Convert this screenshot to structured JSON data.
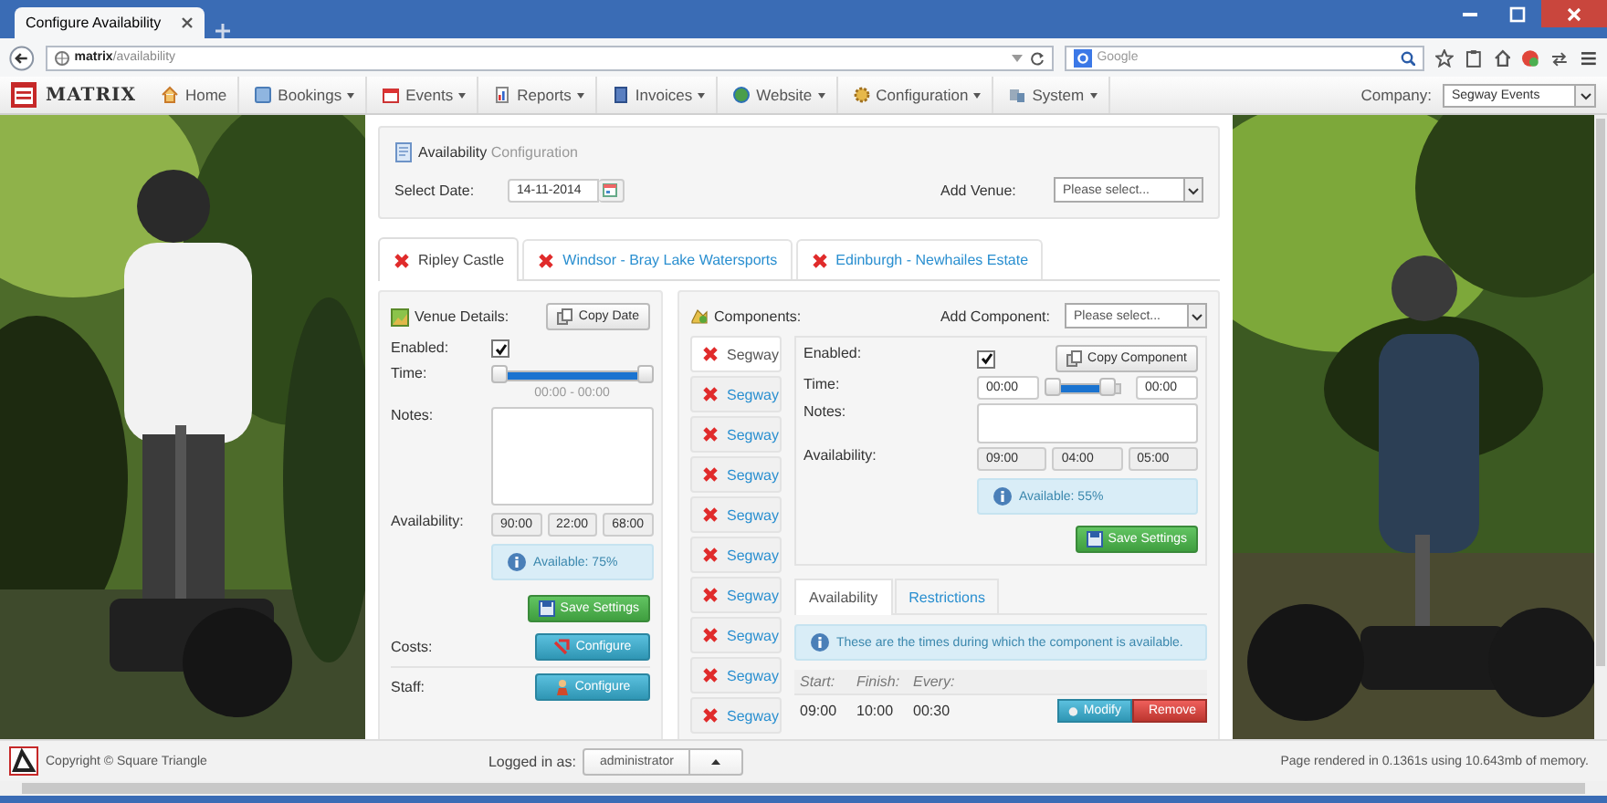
{
  "browser": {
    "tab_title": "Configure Availability",
    "url": {
      "host": "matrix",
      "path": "/availability"
    },
    "search": {
      "placeholder": "Google"
    }
  },
  "navbar": {
    "logo": "MATRIX",
    "items": [
      {
        "label": "Home",
        "dropdown": false,
        "kind": "home"
      },
      {
        "label": "Bookings",
        "dropdown": true,
        "kind": "bookings"
      },
      {
        "label": "Events",
        "dropdown": true,
        "kind": "events"
      },
      {
        "label": "Reports",
        "dropdown": true,
        "kind": "reports"
      },
      {
        "label": "Invoices",
        "dropdown": true,
        "kind": "invoices"
      },
      {
        "label": "Website",
        "dropdown": true,
        "kind": "website"
      },
      {
        "label": "Configuration",
        "dropdown": true,
        "kind": "configuration"
      },
      {
        "label": "System",
        "dropdown": true,
        "kind": "system"
      }
    ],
    "company": {
      "label": "Company:",
      "value": "Segway Events"
    }
  },
  "header": {
    "title": "Availability",
    "subtitle": "Configuration",
    "select_date": {
      "label": "Select Date:",
      "value": "14-11-2014"
    },
    "add_venue": {
      "label": "Add Venue:",
      "placeholder": "Please select..."
    }
  },
  "venue_tabs": [
    {
      "label": "Ripley Castle",
      "selected": true
    },
    {
      "label": "Windsor - Bray Lake Watersports",
      "selected": false
    },
    {
      "label": "Edinburgh - Newhailes Estate",
      "selected": false
    }
  ],
  "venue": {
    "heading": "Venue Details:",
    "copy_button": "Copy Date",
    "enabled": {
      "label": "Enabled:",
      "checked": true
    },
    "time": {
      "label": "Time:",
      "level": 1,
      "reading": "00:00 - 00:00"
    },
    "notes": {
      "label": "Notes:"
    },
    "availability": {
      "label": "Availability:",
      "values": [
        "90:00",
        "22:00",
        "68:00"
      ],
      "note": "Available: 75%"
    },
    "save_button": "Save Settings",
    "costs": {
      "label": "Costs:",
      "button": "Configure"
    },
    "staff": {
      "label": "Staff:",
      "button": "Configure"
    }
  },
  "components": {
    "heading": "Components:",
    "add": {
      "label": "Add Component:",
      "placeholder": "Please select..."
    },
    "items": [
      {
        "label": "Segway",
        "selected": true
      },
      {
        "label": "Segway",
        "selected": false
      },
      {
        "label": "Segway",
        "selected": false
      },
      {
        "label": "Segway",
        "selected": false
      },
      {
        "label": "Segway",
        "selected": false
      },
      {
        "label": "Segway",
        "selected": false
      },
      {
        "label": "Segway",
        "selected": false
      },
      {
        "label": "Segway",
        "selected": false
      },
      {
        "label": "Segway",
        "selected": false
      },
      {
        "label": "Segway",
        "selected": false
      }
    ],
    "detail": {
      "enabled": {
        "label": "Enabled:",
        "checked": true
      },
      "copy_button": "Copy Component",
      "time": {
        "label": "Time:",
        "from": "00:00",
        "to": "00:00",
        "level": 0.8
      },
      "notes": {
        "label": "Notes:"
      },
      "availability": {
        "label": "Availability:",
        "values": [
          "09:00",
          "04:00",
          "05:00"
        ],
        "note": "Available: 55%"
      },
      "save_button": "Save Settings"
    },
    "tabs": [
      {
        "label": "Availability",
        "selected": true
      },
      {
        "label": "Restrictions",
        "selected": false
      }
    ],
    "info": "These are the times during which the component is available.",
    "table": {
      "columns": [
        "Start:",
        "Finish:",
        "Every:"
      ],
      "rows": [
        {
          "start": "09:00",
          "finish": "10:00",
          "every": "00:30",
          "modify": "Modify",
          "remove": "Remove"
        }
      ]
    }
  },
  "footer": {
    "copyright": "Copyright © Square Triangle",
    "logged_in_label": "Logged in as:",
    "user": "administrator",
    "rendered": "Page rendered in 0.1361s using 10.643mb of memory."
  }
}
